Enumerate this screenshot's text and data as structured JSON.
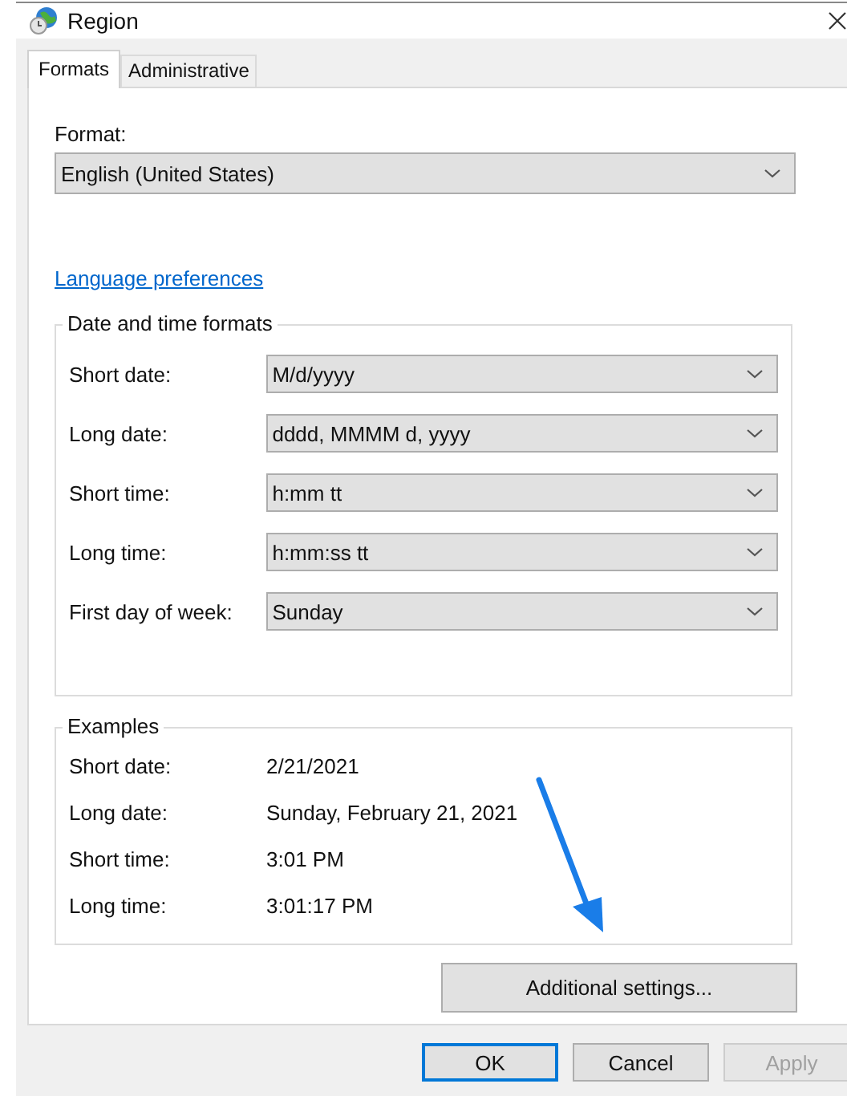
{
  "window": {
    "title": "Region"
  },
  "tabs": [
    {
      "label": "Formats",
      "selected": true
    },
    {
      "label": "Administrative",
      "selected": false
    }
  ],
  "format": {
    "label": "Format:",
    "value": "English (United States)"
  },
  "language_link": "Language preferences",
  "date_time_formats": {
    "title": "Date and time formats",
    "fields": [
      {
        "label": "Short date:",
        "value": "M/d/yyyy"
      },
      {
        "label": "Long date:",
        "value": "dddd, MMMM d, yyyy"
      },
      {
        "label": "Short time:",
        "value": "h:mm tt"
      },
      {
        "label": "Long time:",
        "value": "h:mm:ss tt"
      },
      {
        "label": "First day of week:",
        "value": "Sunday"
      }
    ]
  },
  "examples": {
    "title": "Examples",
    "rows": [
      {
        "label": "Short date:",
        "value": "2/21/2021"
      },
      {
        "label": "Long date:",
        "value": "Sunday, February 21, 2021"
      },
      {
        "label": "Short time:",
        "value": "3:01 PM"
      },
      {
        "label": "Long time:",
        "value": "3:01:17 PM"
      }
    ]
  },
  "additional_settings_button": "Additional settings...",
  "buttons": [
    {
      "label": "OK",
      "default": true,
      "disabled": false
    },
    {
      "label": "Cancel",
      "default": false,
      "disabled": false
    },
    {
      "label": "Apply",
      "default": false,
      "disabled": true
    }
  ]
}
